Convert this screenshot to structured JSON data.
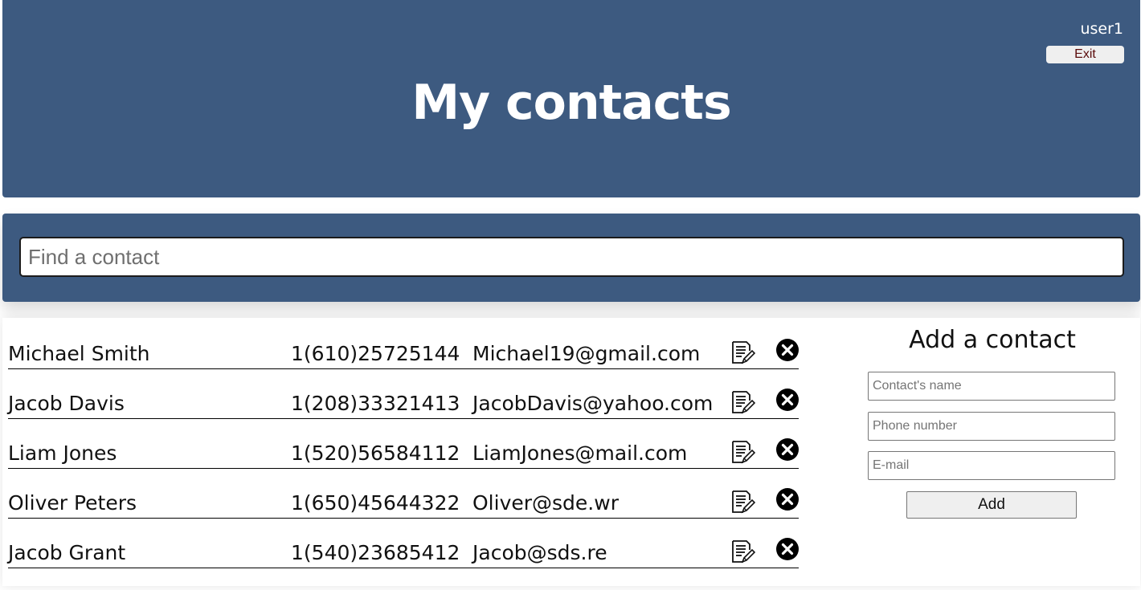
{
  "colors": {
    "brand": "#3d5a80",
    "exit_text": "#5a0b0b"
  },
  "header": {
    "title": "My contacts",
    "username": "user1",
    "exit_label": "Exit"
  },
  "search": {
    "placeholder": "Find a contact",
    "value": ""
  },
  "contacts": [
    {
      "name": "Michael Smith",
      "phone": "1(610)25725144",
      "email": "Michael19@gmail.com"
    },
    {
      "name": "Jacob Davis",
      "phone": "1(208)33321413",
      "email": "JacobDavis@yahoo.com"
    },
    {
      "name": "Liam Jones",
      "phone": "1(520)56584112",
      "email": "LiamJones@mail.com"
    },
    {
      "name": "Oliver Peters",
      "phone": "1(650)45644322",
      "email": "Oliver@sde.wr"
    },
    {
      "name": "Jacob Grant",
      "phone": "1(540)23685412",
      "email": "Jacob@sds.re"
    }
  ],
  "row_icons": {
    "edit": "edit-icon",
    "delete": "delete-icon"
  },
  "add_form": {
    "title": "Add a contact",
    "name_placeholder": "Contact's name",
    "phone_placeholder": "Phone number",
    "email_placeholder": "E-mail",
    "button_label": "Add"
  }
}
